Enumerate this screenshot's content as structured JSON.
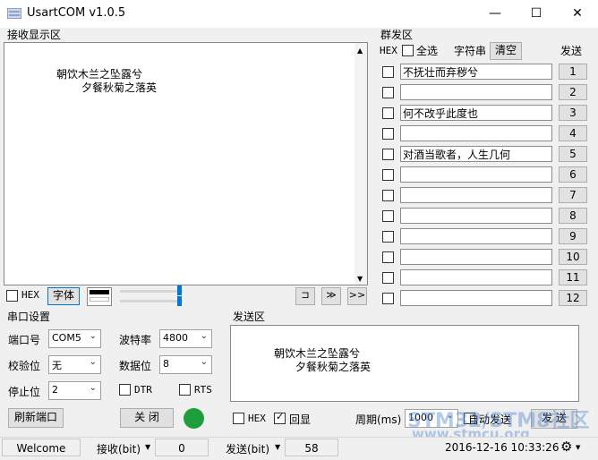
{
  "window": {
    "title": "UsartCOM v1.0.5",
    "min": "—",
    "max": "☐",
    "close": "✕"
  },
  "receive": {
    "section_title": "接收显示区",
    "lines": [
      "朝饮木兰之坠露兮",
      "夕餐秋菊之落英"
    ],
    "hex_label": "HEX",
    "font_button": "字体",
    "scroll_btns": [
      "⊐",
      "≫",
      ">>"
    ]
  },
  "group_send": {
    "section_title": "群发区",
    "hex_label": "HEX",
    "select_all": "全选",
    "string_label": "字符串",
    "clear_button": "清空",
    "send_header": "发送",
    "rows": [
      {
        "text": "不抚壮而弃秽兮",
        "btn": "1"
      },
      {
        "text": "",
        "btn": "2"
      },
      {
        "text": "何不改乎此度也",
        "btn": "3"
      },
      {
        "text": "",
        "btn": "4"
      },
      {
        "text": "对酒当歌者，人生几何",
        "btn": "5"
      },
      {
        "text": "",
        "btn": "6"
      },
      {
        "text": "",
        "btn": "7"
      },
      {
        "text": "",
        "btn": "8"
      },
      {
        "text": "",
        "btn": "9"
      },
      {
        "text": "",
        "btn": "10"
      },
      {
        "text": "",
        "btn": "11"
      },
      {
        "text": "",
        "btn": "12"
      }
    ]
  },
  "port": {
    "section_title": "串口设置",
    "port_label": "端口号",
    "port_value": "COM5",
    "baud_label": "波特率",
    "baud_value": "4800",
    "parity_label": "校验位",
    "parity_value": "无",
    "databits_label": "数据位",
    "databits_value": "8",
    "stopbits_label": "停止位",
    "stopbits_value": "2",
    "dtr_label": "DTR",
    "rts_label": "RTS",
    "refresh_button": "刷新端口",
    "close_button": "关  闭",
    "status_color": "#1e9e3c"
  },
  "send": {
    "section_title": "发送区",
    "lines": [
      "朝饮木兰之坠露兮",
      "夕餐秋菊之落英"
    ],
    "hex_label": "HEX",
    "echo_label": "回显",
    "period_label": "周期(ms)",
    "period_value": "1000",
    "auto_send_label": "自动发送",
    "send_button": "发  送"
  },
  "status": {
    "welcome": "Welcome",
    "recv_label": "接收(bit)",
    "recv_value": "0",
    "sent_label": "发送(bit)",
    "sent_value": "58",
    "datetime": "2016-12-16 10:33:26"
  },
  "watermark": {
    "line1": "STM32/STM8社区",
    "line2": "www.stmcu.org"
  }
}
